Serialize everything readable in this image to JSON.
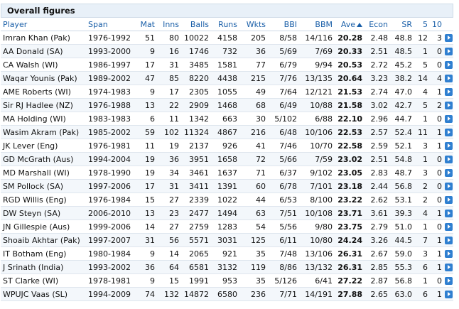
{
  "section_title": "Overall figures",
  "columns": {
    "player": "Player",
    "span": "Span",
    "mat": "Mat",
    "inns": "Inns",
    "balls": "Balls",
    "runs": "Runs",
    "wkts": "Wkts",
    "bbi": "BBI",
    "bbm": "BBM",
    "ave": "Ave",
    "econ": "Econ",
    "sr": "SR",
    "five": "5",
    "ten": "10"
  },
  "sorted_column": "Ave",
  "rows": [
    {
      "player": "Imran Khan (Pak)",
      "span": "1976-1992",
      "mat": "51",
      "inns": "80",
      "balls": "10022",
      "runs": "4158",
      "wkts": "205",
      "bbi": "8/58",
      "bbm": "14/116",
      "ave": "20.28",
      "econ": "2.48",
      "sr": "48.8",
      "five": "12",
      "ten": "3"
    },
    {
      "player": "AA Donald (SA)",
      "span": "1993-2000",
      "mat": "9",
      "inns": "16",
      "balls": "1746",
      "runs": "732",
      "wkts": "36",
      "bbi": "5/69",
      "bbm": "7/69",
      "ave": "20.33",
      "econ": "2.51",
      "sr": "48.5",
      "five": "1",
      "ten": "0"
    },
    {
      "player": "CA Walsh (WI)",
      "span": "1986-1997",
      "mat": "17",
      "inns": "31",
      "balls": "3485",
      "runs": "1581",
      "wkts": "77",
      "bbi": "6/79",
      "bbm": "9/94",
      "ave": "20.53",
      "econ": "2.72",
      "sr": "45.2",
      "five": "5",
      "ten": "0"
    },
    {
      "player": "Waqar Younis (Pak)",
      "span": "1989-2002",
      "mat": "47",
      "inns": "85",
      "balls": "8220",
      "runs": "4438",
      "wkts": "215",
      "bbi": "7/76",
      "bbm": "13/135",
      "ave": "20.64",
      "econ": "3.23",
      "sr": "38.2",
      "five": "14",
      "ten": "4"
    },
    {
      "player": "AME Roberts (WI)",
      "span": "1974-1983",
      "mat": "9",
      "inns": "17",
      "balls": "2305",
      "runs": "1055",
      "wkts": "49",
      "bbi": "7/64",
      "bbm": "12/121",
      "ave": "21.53",
      "econ": "2.74",
      "sr": "47.0",
      "five": "4",
      "ten": "1"
    },
    {
      "player": "Sir RJ Hadlee (NZ)",
      "span": "1976-1988",
      "mat": "13",
      "inns": "22",
      "balls": "2909",
      "runs": "1468",
      "wkts": "68",
      "bbi": "6/49",
      "bbm": "10/88",
      "ave": "21.58",
      "econ": "3.02",
      "sr": "42.7",
      "five": "5",
      "ten": "2"
    },
    {
      "player": "MA Holding (WI)",
      "span": "1983-1983",
      "mat": "6",
      "inns": "11",
      "balls": "1342",
      "runs": "663",
      "wkts": "30",
      "bbi": "5/102",
      "bbm": "6/88",
      "ave": "22.10",
      "econ": "2.96",
      "sr": "44.7",
      "five": "1",
      "ten": "0"
    },
    {
      "player": "Wasim Akram (Pak)",
      "span": "1985-2002",
      "mat": "59",
      "inns": "102",
      "balls": "11324",
      "runs": "4867",
      "wkts": "216",
      "bbi": "6/48",
      "bbm": "10/106",
      "ave": "22.53",
      "econ": "2.57",
      "sr": "52.4",
      "five": "11",
      "ten": "1"
    },
    {
      "player": "JK Lever (Eng)",
      "span": "1976-1981",
      "mat": "11",
      "inns": "19",
      "balls": "2137",
      "runs": "926",
      "wkts": "41",
      "bbi": "7/46",
      "bbm": "10/70",
      "ave": "22.58",
      "econ": "2.59",
      "sr": "52.1",
      "five": "3",
      "ten": "1"
    },
    {
      "player": "GD McGrath (Aus)",
      "span": "1994-2004",
      "mat": "19",
      "inns": "36",
      "balls": "3951",
      "runs": "1658",
      "wkts": "72",
      "bbi": "5/66",
      "bbm": "7/59",
      "ave": "23.02",
      "econ": "2.51",
      "sr": "54.8",
      "five": "1",
      "ten": "0"
    },
    {
      "player": "MD Marshall (WI)",
      "span": "1978-1990",
      "mat": "19",
      "inns": "34",
      "balls": "3461",
      "runs": "1637",
      "wkts": "71",
      "bbi": "6/37",
      "bbm": "9/102",
      "ave": "23.05",
      "econ": "2.83",
      "sr": "48.7",
      "five": "3",
      "ten": "0"
    },
    {
      "player": "SM Pollock (SA)",
      "span": "1997-2006",
      "mat": "17",
      "inns": "31",
      "balls": "3411",
      "runs": "1391",
      "wkts": "60",
      "bbi": "6/78",
      "bbm": "7/101",
      "ave": "23.18",
      "econ": "2.44",
      "sr": "56.8",
      "five": "2",
      "ten": "0"
    },
    {
      "player": "RGD Willis (Eng)",
      "span": "1976-1984",
      "mat": "15",
      "inns": "27",
      "balls": "2339",
      "runs": "1022",
      "wkts": "44",
      "bbi": "6/53",
      "bbm": "8/100",
      "ave": "23.22",
      "econ": "2.62",
      "sr": "53.1",
      "five": "2",
      "ten": "0"
    },
    {
      "player": "DW Steyn (SA)",
      "span": "2006-2010",
      "mat": "13",
      "inns": "23",
      "balls": "2477",
      "runs": "1494",
      "wkts": "63",
      "bbi": "7/51",
      "bbm": "10/108",
      "ave": "23.71",
      "econ": "3.61",
      "sr": "39.3",
      "five": "4",
      "ten": "1"
    },
    {
      "player": "JN Gillespie (Aus)",
      "span": "1999-2006",
      "mat": "14",
      "inns": "27",
      "balls": "2759",
      "runs": "1283",
      "wkts": "54",
      "bbi": "5/56",
      "bbm": "9/80",
      "ave": "23.75",
      "econ": "2.79",
      "sr": "51.0",
      "five": "1",
      "ten": "0"
    },
    {
      "player": "Shoaib Akhtar (Pak)",
      "span": "1997-2007",
      "mat": "31",
      "inns": "56",
      "balls": "5571",
      "runs": "3031",
      "wkts": "125",
      "bbi": "6/11",
      "bbm": "10/80",
      "ave": "24.24",
      "econ": "3.26",
      "sr": "44.5",
      "five": "7",
      "ten": "1"
    },
    {
      "player": "IT Botham (Eng)",
      "span": "1980-1984",
      "mat": "9",
      "inns": "14",
      "balls": "2065",
      "runs": "921",
      "wkts": "35",
      "bbi": "7/48",
      "bbm": "13/106",
      "ave": "26.31",
      "econ": "2.67",
      "sr": "59.0",
      "five": "3",
      "ten": "1"
    },
    {
      "player": "J Srinath (India)",
      "span": "1993-2002",
      "mat": "36",
      "inns": "64",
      "balls": "6581",
      "runs": "3132",
      "wkts": "119",
      "bbi": "8/86",
      "bbm": "13/132",
      "ave": "26.31",
      "econ": "2.85",
      "sr": "55.3",
      "five": "6",
      "ten": "1"
    },
    {
      "player": "ST Clarke (WI)",
      "span": "1978-1981",
      "mat": "9",
      "inns": "15",
      "balls": "1991",
      "runs": "953",
      "wkts": "35",
      "bbi": "5/126",
      "bbm": "6/41",
      "ave": "27.22",
      "econ": "2.87",
      "sr": "56.8",
      "five": "1",
      "ten": "0"
    },
    {
      "player": "WPUJC Vaas (SL)",
      "span": "1994-2009",
      "mat": "74",
      "inns": "132",
      "balls": "14872",
      "runs": "6580",
      "wkts": "236",
      "bbi": "7/71",
      "bbm": "14/191",
      "ave": "27.88",
      "econ": "2.65",
      "sr": "63.0",
      "five": "6",
      "ten": "1"
    }
  ]
}
